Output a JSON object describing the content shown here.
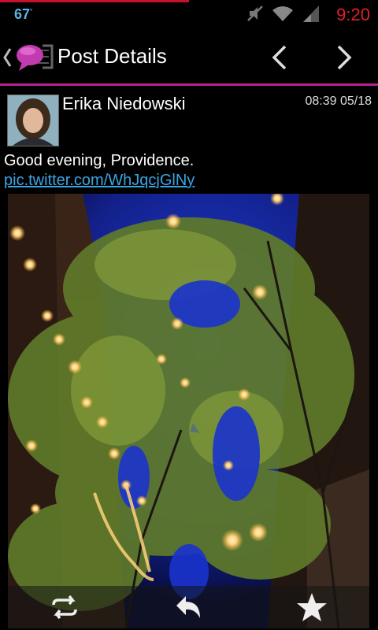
{
  "status_bar": {
    "temperature": "67",
    "temperature_unit": "°",
    "time": "9:20",
    "accent_color": "#e0202a"
  },
  "action_bar": {
    "title": "Post Details",
    "divider_color": "#b4248e"
  },
  "post": {
    "author": "Erika Niedowski",
    "timestamp": "08:39 05/18",
    "text": "Good evening, Providence. ",
    "link_text": "pic.twitter.com/WhJqcjGlNy",
    "link_color": "#39a5e3"
  },
  "icons": {
    "status": [
      "mute-icon",
      "wifi-icon",
      "signal-icon"
    ],
    "action_bar": [
      "back-icon",
      "app-logo-icon",
      "prev-icon",
      "next-icon"
    ],
    "post_actions": [
      "retweet-icon",
      "reply-icon",
      "favorite-icon"
    ]
  }
}
